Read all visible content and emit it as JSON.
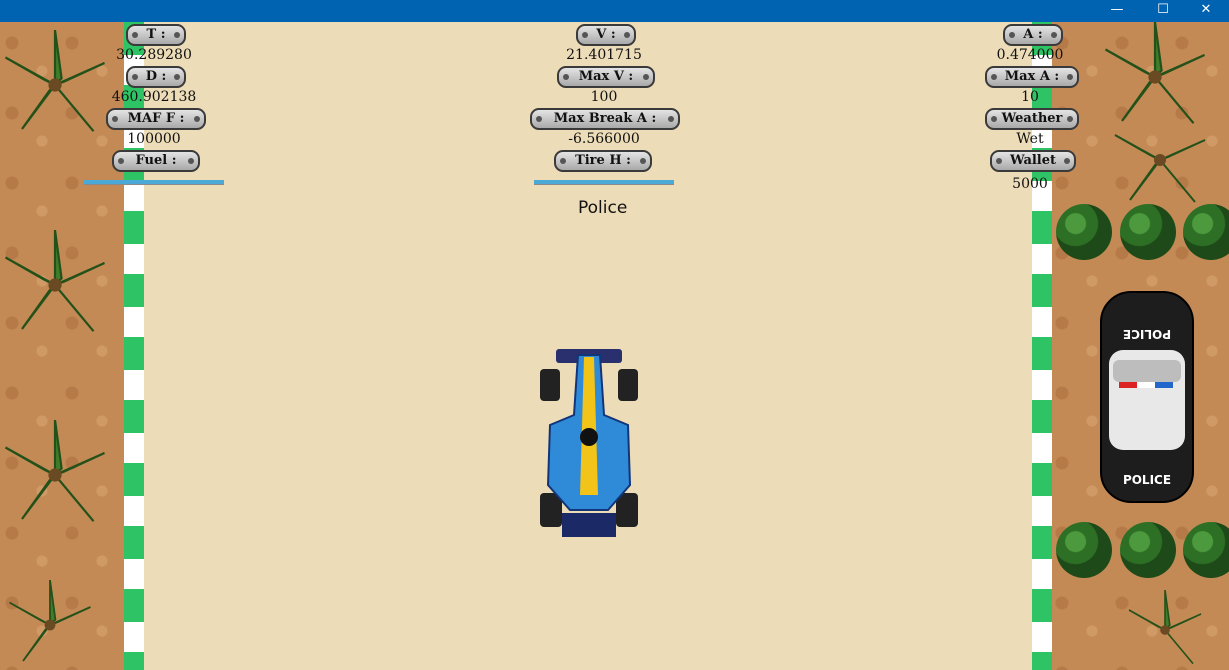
{
  "window": {
    "minimize_glyph": "—",
    "maximize_glyph": "☐",
    "close_glyph": "✕"
  },
  "hud_left": [
    {
      "label": "T :",
      "value": "30.289280"
    },
    {
      "label": "D :",
      "value": "460.902138"
    },
    {
      "label": "MAF F :",
      "value": "100000"
    },
    {
      "label": "Fuel :",
      "value": ""
    }
  ],
  "hud_center": [
    {
      "label": "V :",
      "value": "21.401715"
    },
    {
      "label": "Max V :",
      "value": "100"
    },
    {
      "label": "Max Break A :",
      "value": "-6.566000"
    },
    {
      "label": "Tire H :",
      "value": ""
    }
  ],
  "hud_right": [
    {
      "label": "A :",
      "value": "0.474000"
    },
    {
      "label": "Max A :",
      "value": "10"
    },
    {
      "label": "Weather",
      "value": "Wet"
    },
    {
      "label": "Wallet",
      "value": "5000"
    }
  ],
  "fuel_level": 1.0,
  "tire_health_level": 1.0,
  "mode_label": "Police",
  "police_car": {
    "roof_text": "POLICE",
    "trunk_text": "POLICE"
  },
  "colors": {
    "titlebar": "#0063b1",
    "road": "#ecdcb8",
    "stripe_green": "#2ec466",
    "bar": "#4aa9d6"
  }
}
